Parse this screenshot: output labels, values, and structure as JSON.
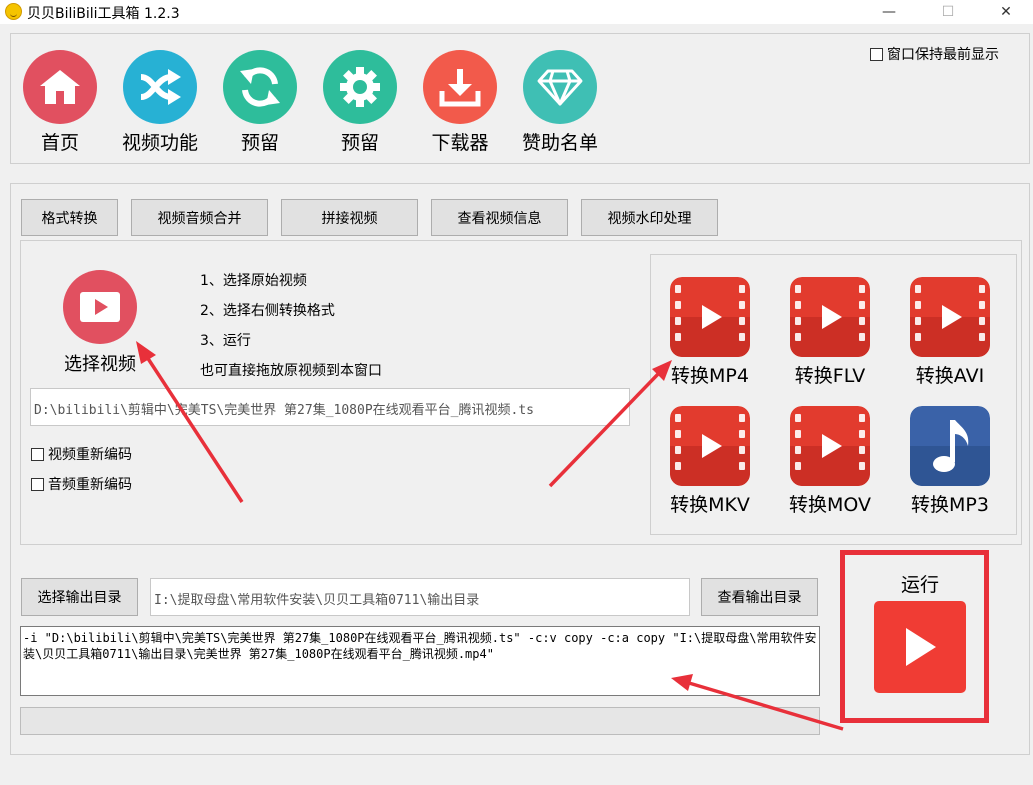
{
  "window": {
    "title": "贝贝BiliBili工具箱 1.2.3",
    "controls": {
      "minimize": "—",
      "maximize": "☐",
      "close": "✕"
    }
  },
  "topbar": {
    "keep_on_top_label": "窗口保持最前显示",
    "keep_on_top_checked": false,
    "nav": [
      {
        "label": "首页",
        "icon": "home-icon",
        "color": "#e15060"
      },
      {
        "label": "视频功能",
        "icon": "shuffle-icon",
        "color": "#27b1d4"
      },
      {
        "label": "预留",
        "icon": "refresh-icon",
        "color": "#2ebd9b"
      },
      {
        "label": "预留",
        "icon": "gear-icon",
        "color": "#2ebd9b"
      },
      {
        "label": "下载器",
        "icon": "download-icon",
        "color": "#f25a4b"
      },
      {
        "label": "赞助名单",
        "icon": "diamond-icon",
        "color": "#3fbfb4"
      }
    ]
  },
  "tabs": [
    "格式转换",
    "视频音频合并",
    "拼接视频",
    "查看视频信息",
    "视频水印处理"
  ],
  "convert": {
    "select_video_label": "选择视频",
    "steps": [
      "1、选择原始视频",
      "2、选择右侧转换格式",
      "3、运行",
      "也可直接拖放原视频到本窗口"
    ],
    "input_path": "D:\\bilibili\\剪辑中\\完美TS\\完美世界 第27集_1080P在线观看平台_腾讯视频.ts",
    "reencode_video_label": "视频重新编码",
    "reencode_audio_label": "音频重新编码",
    "reencode_video_checked": false,
    "reencode_audio_checked": false,
    "formats": [
      {
        "label": "转换MP4",
        "icon": "film-play-icon"
      },
      {
        "label": "转换FLV",
        "icon": "film-play-icon"
      },
      {
        "label": "转换AVI",
        "icon": "film-play-icon"
      },
      {
        "label": "转换MKV",
        "icon": "film-play-icon"
      },
      {
        "label": "转换MOV",
        "icon": "film-play-icon"
      },
      {
        "label": "转换MP3",
        "icon": "music-note-icon"
      }
    ]
  },
  "output": {
    "select_dir_button": "选择输出目录",
    "dir_path": "I:\\提取母盘\\常用软件安装\\贝贝工具箱0711\\输出目录",
    "view_dir_button": "查看输出目录",
    "command": "-i \"D:\\bilibili\\剪辑中\\完美TS\\完美世界 第27集_1080P在线观看平台_腾讯视频.ts\" -c:v copy -c:a copy \"I:\\提取母盘\\常用软件安装\\贝贝工具箱0711\\输出目录\\完美世界 第27集_1080P在线观看平台_腾讯视频.mp4\"",
    "progress": 0
  },
  "run": {
    "label": "运行",
    "accent": "#f03c34"
  },
  "annotation_color": "#e8303a"
}
